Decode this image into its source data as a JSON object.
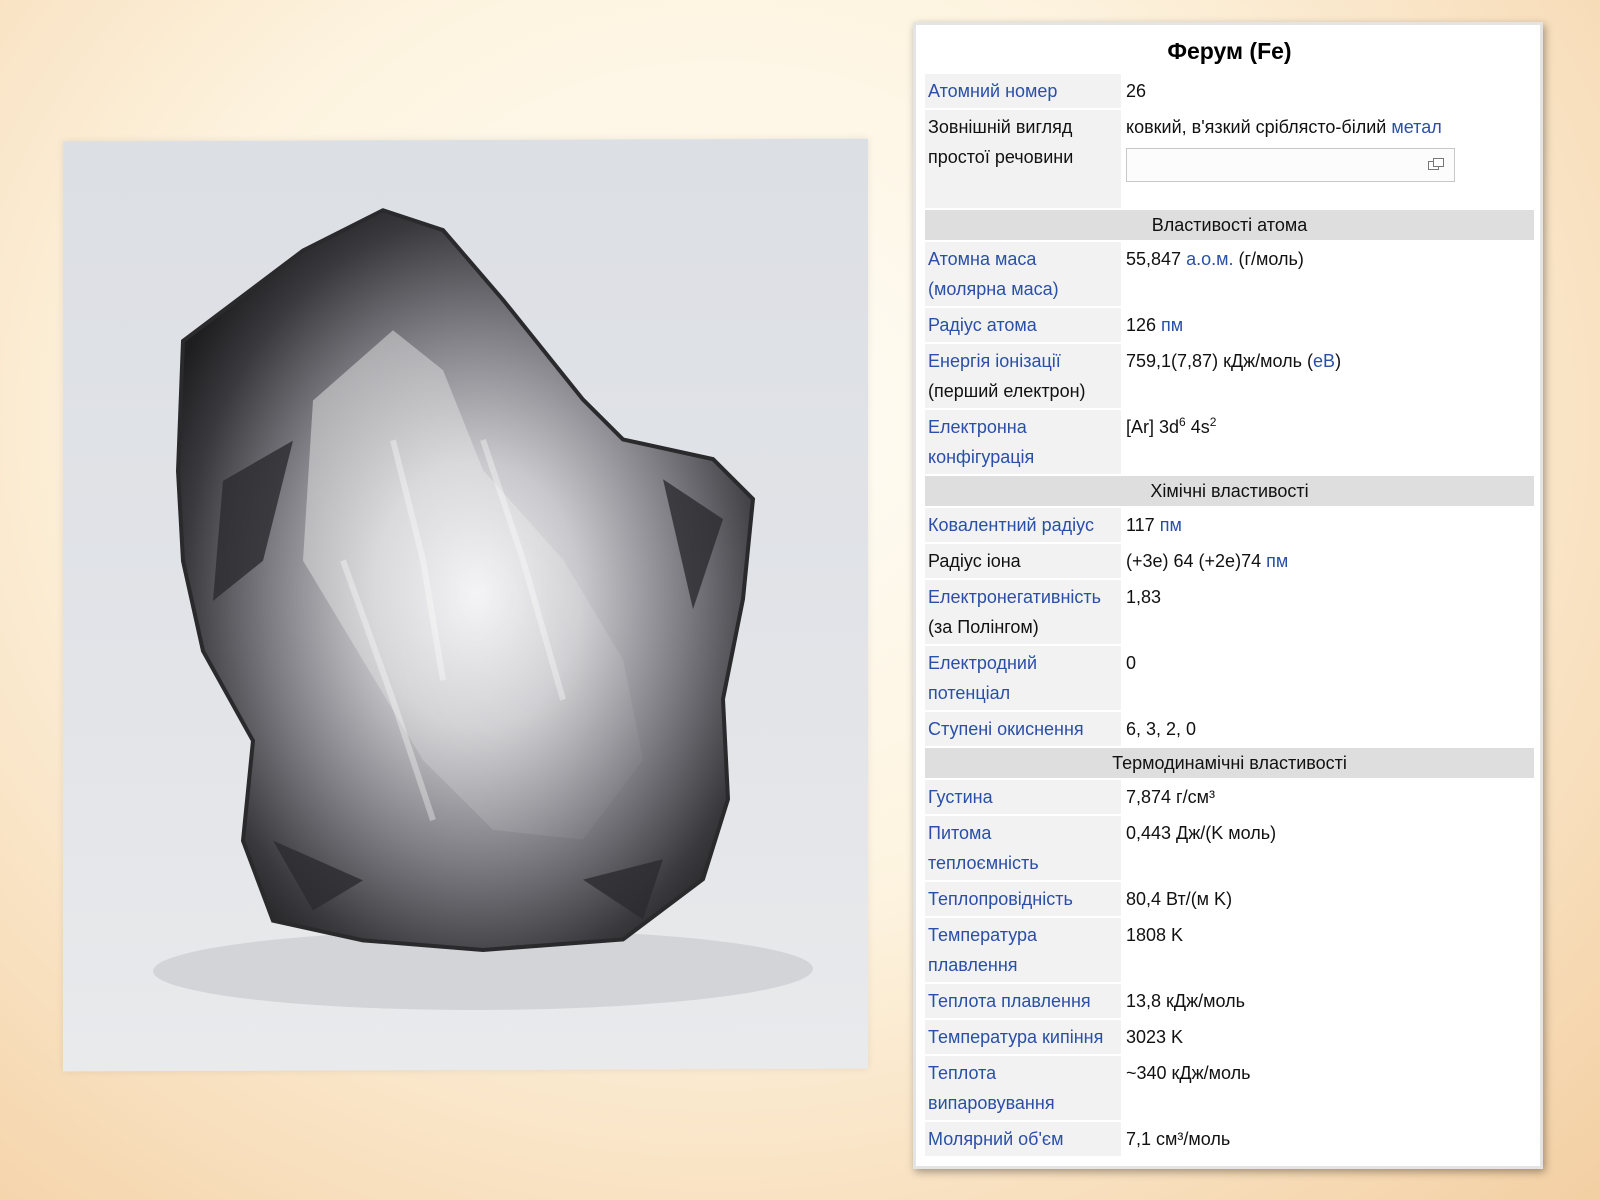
{
  "photo": {
    "subject": "iron-nugget"
  },
  "infobox": {
    "title": "Ферум (Fe)",
    "atomic_number": {
      "label": "Атомний номер",
      "value": "26"
    },
    "appearance": {
      "label_line1": "Зовнішній вигляд",
      "label_line2": "простої речовини",
      "value_text": "ковкий, в'язкий сріблясто-білий ",
      "value_link": "метал"
    },
    "section_atom": "Властивості атома",
    "atomic_mass": {
      "label_line1": "Атомна маса",
      "label_line2": "(молярна маса)",
      "value_num": "55,847 ",
      "value_link": "а.о.м.",
      "value_unit": " (г/моль)"
    },
    "atomic_radius": {
      "label": "Радіус атома",
      "value_num": "126 ",
      "value_link": "пм"
    },
    "ionization": {
      "label_line1": "Енергія іонізації",
      "label_line2": "(перший електрон)",
      "value_text": "759,1(7,87) кДж/моль (",
      "value_link": "еВ",
      "value_close": ")"
    },
    "electron_config": {
      "label_line1": "Електронна",
      "label_line2": "конфігурація",
      "base": "[Ar] 3d",
      "sup1": "6",
      "mid": " 4s",
      "sup2": "2"
    },
    "section_chem": "Хімічні властивості",
    "covalent_radius": {
      "label": "Ковалентний радіус",
      "value_num": "117 ",
      "value_link": "пм"
    },
    "ion_radius": {
      "label": "Радіус іона",
      "value_num": "(+3e) 64 (+2e)74 ",
      "value_link": "пм"
    },
    "electronegativity": {
      "label_line1": "Електронегативність",
      "label_line2": "(за Полінгом)",
      "value": "1,83"
    },
    "electrode_potential": {
      "label_line1": "Електродний",
      "label_line2": "потенціал",
      "value": "0"
    },
    "oxidation_states": {
      "label": "Ступені окиснення",
      "value": "6, 3, 2, 0"
    },
    "section_thermo": "Термодинамічні властивості",
    "density": {
      "label": "Густина",
      "value": "7,874 г/см³"
    },
    "specific_heat": {
      "label_line1": "Питома",
      "label_line2": "теплоємність",
      "value": "0,443 Дж/(K моль)"
    },
    "thermal_conductivity": {
      "label": "Теплопровідність",
      "value": "80,4 Вт/(м K)"
    },
    "melting_temp": {
      "label_line1": "Температура",
      "label_line2": "плавлення",
      "value": "1808 K"
    },
    "heat_of_fusion": {
      "label": "Теплота плавлення",
      "value": "13,8 кДж/моль"
    },
    "boiling_temp": {
      "label": "Температура кипіння",
      "value": "3023 K"
    },
    "heat_of_vaporization": {
      "label_line1": "Теплота",
      "label_line2": "випаровування",
      "value": "~340 кДж/моль"
    },
    "molar_volume": {
      "label": "Молярний об'єм",
      "value": "7,1 см³/моль"
    }
  }
}
